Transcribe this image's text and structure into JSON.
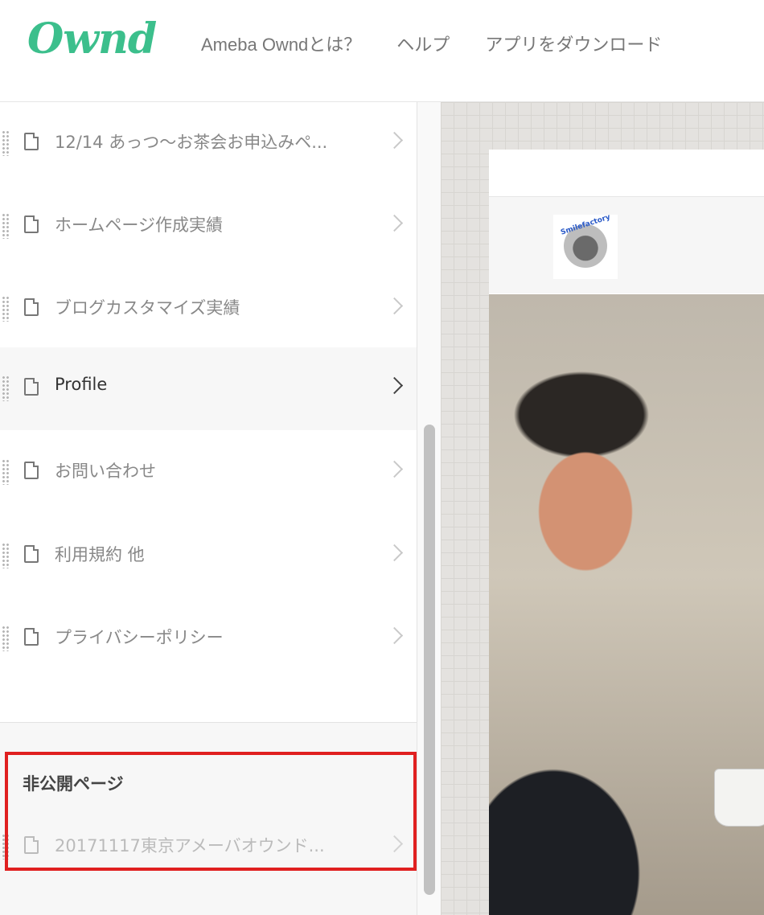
{
  "header": {
    "logo_text": "Ownd",
    "nav": [
      "Ameba Owndとは？",
      "ヘルプ",
      "アプリをダウンロード"
    ]
  },
  "sidebar": {
    "pages": [
      {
        "label": "12/14 あっつ〜お茶会お申込みペ...",
        "active": false
      },
      {
        "label": "ホームページ作成実績",
        "active": false
      },
      {
        "label": "ブログカスタマイズ実績",
        "active": false
      },
      {
        "label": "Profile",
        "active": true
      },
      {
        "label": "お問い合わせ",
        "active": false
      },
      {
        "label": "利用規約 他",
        "active": false
      },
      {
        "label": "プライバシーポリシー",
        "active": false
      }
    ],
    "private_section": {
      "title": "非公開ページ",
      "items": [
        {
          "label": "20171117東京アメーバオウンド..."
        }
      ]
    }
  },
  "preview": {
    "logo_text": "Smilefactory"
  },
  "colors": {
    "brand": "#3cbf8c",
    "highlight": "#e02020"
  }
}
